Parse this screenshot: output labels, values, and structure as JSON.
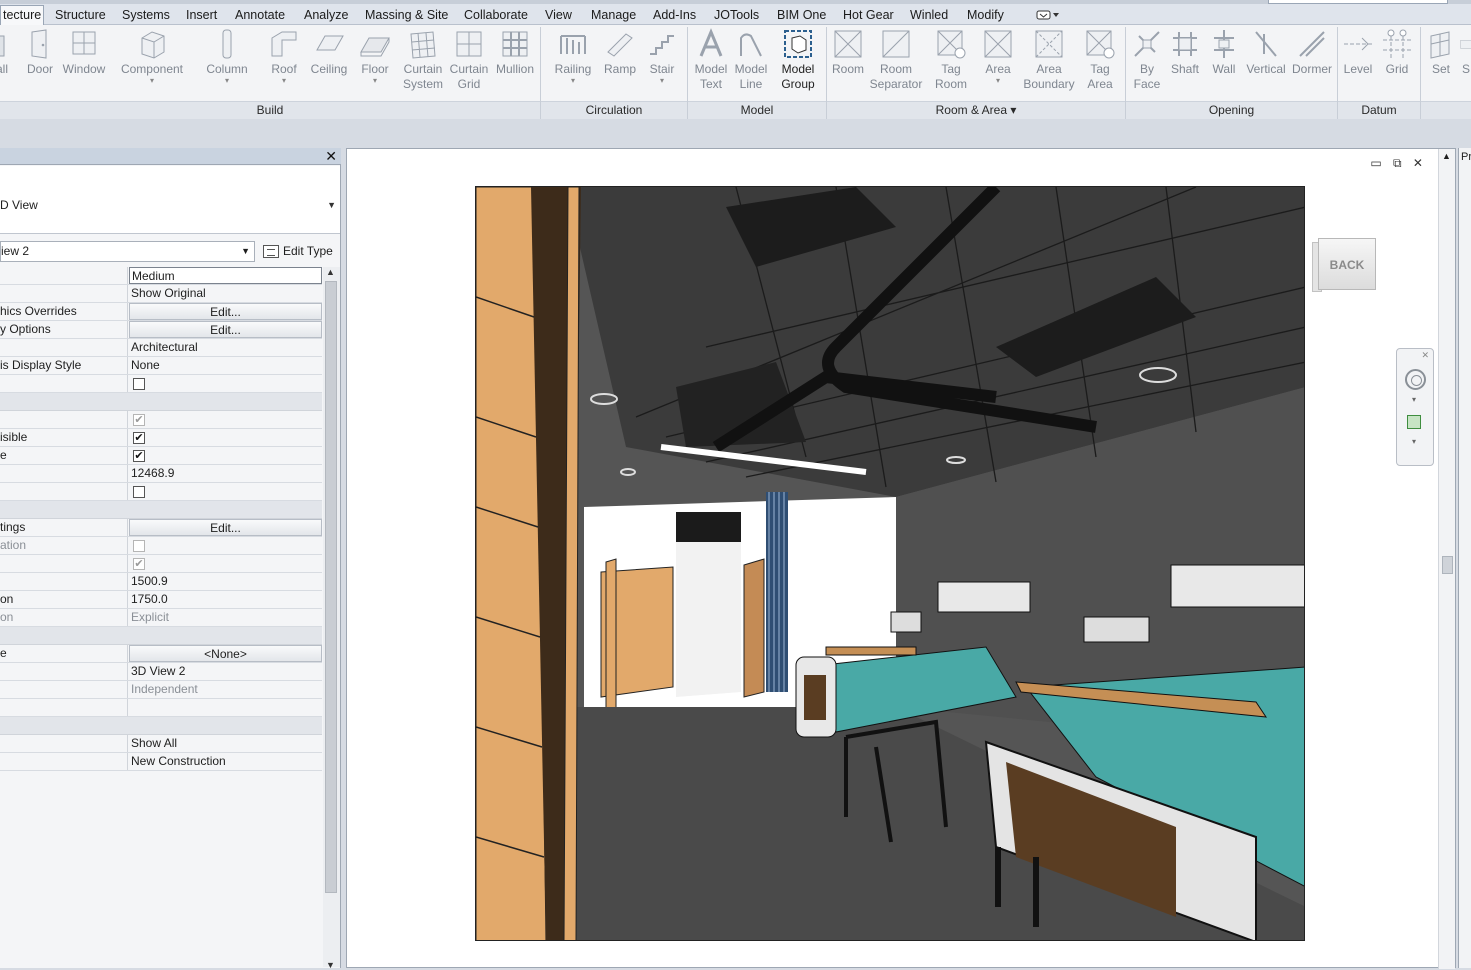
{
  "ribbon_tabs": [
    {
      "label": "tecture",
      "active": true
    },
    {
      "label": "Structure"
    },
    {
      "label": "Systems"
    },
    {
      "label": "Insert"
    },
    {
      "label": "Annotate"
    },
    {
      "label": "Analyze"
    },
    {
      "label": "Massing & Site"
    },
    {
      "label": "Collaborate"
    },
    {
      "label": "View"
    },
    {
      "label": "Manage"
    },
    {
      "label": "Add-Ins"
    },
    {
      "label": "JOTools"
    },
    {
      "label": "BIM One"
    },
    {
      "label": "Hot Gear"
    },
    {
      "label": "Winled"
    },
    {
      "label": "Modify"
    }
  ],
  "ribbon": {
    "tools": {
      "wall": {
        "line1": "all"
      },
      "door": {
        "line1": "Door"
      },
      "window": {
        "line1": "Window"
      },
      "component": {
        "line1": "Component"
      },
      "column": {
        "line1": "Column"
      },
      "roof": {
        "line1": "Roof"
      },
      "ceiling": {
        "line1": "Ceiling"
      },
      "floor": {
        "line1": "Floor"
      },
      "curtain_system": {
        "line1": "Curtain",
        "line2": "System"
      },
      "curtain_grid": {
        "line1": "Curtain",
        "line2": "Grid"
      },
      "mullion": {
        "line1": "Mullion"
      },
      "railing": {
        "line1": "Railing"
      },
      "ramp": {
        "line1": "Ramp"
      },
      "stair": {
        "line1": "Stair"
      },
      "model_text": {
        "line1": "Model",
        "line2": "Text"
      },
      "model_line": {
        "line1": "Model",
        "line2": "Line"
      },
      "model_group": {
        "line1": "Model",
        "line2": "Group"
      },
      "room": {
        "line1": "Room"
      },
      "room_separator": {
        "line1": "Room",
        "line2": "Separator"
      },
      "tag_room": {
        "line1": "Tag",
        "line2": "Room"
      },
      "area": {
        "line1": "Area"
      },
      "area_boundary": {
        "line1": "Area",
        "line2": "Boundary"
      },
      "tag_area": {
        "line1": "Tag",
        "line2": "Area"
      },
      "by_face": {
        "line1": "By",
        "line2": "Face"
      },
      "shaft": {
        "line1": "Shaft"
      },
      "wall_opening": {
        "line1": "Wall"
      },
      "vertical": {
        "line1": "Vertical"
      },
      "dormer": {
        "line1": "Dormer"
      },
      "level": {
        "line1": "Level"
      },
      "grid": {
        "line1": "Grid"
      },
      "set": {
        "line1": "Set"
      },
      "s": {
        "line1": "S"
      }
    },
    "panels": {
      "build": "Build",
      "circulation": "Circulation",
      "model": "Model",
      "room_area": "Room & Area ▾",
      "opening": "Opening",
      "datum": "Datum"
    }
  },
  "properties": {
    "close_glyph": "✕",
    "type_label": "D View",
    "filter_value": "iew 2",
    "edit_type_label": "Edit Type",
    "rows": [
      {
        "key": "",
        "value": "Medium",
        "kind": "boxed"
      },
      {
        "key": "",
        "value": "Show Original"
      },
      {
        "key": "hics Overrides",
        "value": "Edit...",
        "kind": "btn"
      },
      {
        "key": "y Options",
        "value": "Edit...",
        "kind": "btn"
      },
      {
        "key": "",
        "value": "Architectural"
      },
      {
        "key": "is Display Style",
        "value": "None"
      },
      {
        "key": "",
        "kind": "check",
        "checked": false
      },
      {
        "key": "",
        "kind": "group"
      },
      {
        "key": "",
        "kind": "check",
        "checked": true,
        "dim": true
      },
      {
        "key": "isible",
        "kind": "check",
        "checked": true
      },
      {
        "key": "e",
        "kind": "check",
        "checked": true
      },
      {
        "key": "",
        "value": "12468.9"
      },
      {
        "key": "",
        "kind": "check",
        "checked": false
      },
      {
        "key": "",
        "kind": "group"
      },
      {
        "key": "tings",
        "value": "Edit...",
        "kind": "btn"
      },
      {
        "key": "ation",
        "kind": "check",
        "checked": false,
        "dim": true,
        "grey": true
      },
      {
        "key": "",
        "kind": "check",
        "checked": true,
        "dim": true
      },
      {
        "key": "",
        "value": "1500.9"
      },
      {
        "key": "on",
        "value": "1750.0"
      },
      {
        "key": "on",
        "value": "Explicit",
        "grey": true
      },
      {
        "key": "",
        "kind": "group"
      },
      {
        "key": "e",
        "value": "<None>",
        "kind": "btn"
      },
      {
        "key": "",
        "value": "3D View 2"
      },
      {
        "key": "",
        "value": "Independent",
        "grey": true
      },
      {
        "key": "",
        "value": ""
      },
      {
        "key": "",
        "kind": "group"
      },
      {
        "key": "",
        "value": "Show All"
      },
      {
        "key": "",
        "value": "New Construction"
      }
    ]
  },
  "view": {
    "window_controls": "▭ ⧉ ✕",
    "viewcube_label": "BACK",
    "navbar_close": "✕"
  },
  "right_pane_label": "Pr",
  "colors": {
    "wood": "#e2a96b",
    "ceiling": "#3b3b3b",
    "floor": "#4b4b4b",
    "bed_teal": "#49a9a6",
    "accent_green": "#3f8d3f"
  }
}
